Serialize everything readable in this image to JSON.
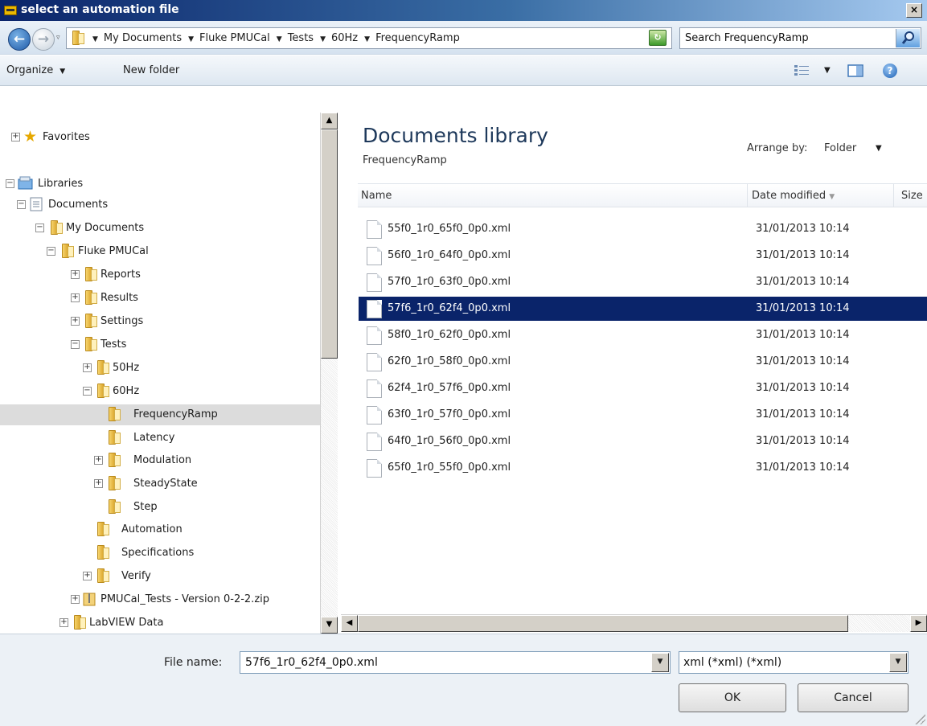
{
  "window": {
    "title": "select an automation file",
    "close_glyph": "×"
  },
  "address": {
    "crumbs": [
      "My Documents",
      "Fluke PMUCal",
      "Tests",
      "60Hz",
      "FrequencyRamp"
    ],
    "search_placeholder": "Search FrequencyRamp"
  },
  "toolbar": {
    "organize_label": "Organize",
    "newfolder_label": "New folder",
    "help_glyph": "?"
  },
  "tree": {
    "favorites": "Favorites",
    "libraries": "Libraries",
    "documents": "Documents",
    "my_documents": "My Documents",
    "fluke_pmucal": "Fluke PMUCal",
    "reports": "Reports",
    "results": "Results",
    "settings": "Settings",
    "tests": "Tests",
    "hz50": "50Hz",
    "hz60": "60Hz",
    "frequencyramp": "FrequencyRamp",
    "latency": "Latency",
    "modulation": "Modulation",
    "steadystate": "SteadyState",
    "step": "Step",
    "automation": "Automation",
    "specifications": "Specifications",
    "verify": "Verify",
    "zip": "PMUCal_Tests - Version 0-2-2.zip",
    "labview": "LabVIEW Data"
  },
  "content": {
    "library_title": "Documents library",
    "library_subtitle": "FrequencyRamp",
    "arrange_label": "Arrange by:",
    "arrange_value": "Folder",
    "columns": {
      "name": "Name",
      "date": "Date modified",
      "size": "Size"
    },
    "files": [
      {
        "name": "55f0_1r0_65f0_0p0.xml",
        "date": "31/01/2013 10:14"
      },
      {
        "name": "56f0_1r0_64f0_0p0.xml",
        "date": "31/01/2013 10:14"
      },
      {
        "name": "57f0_1r0_63f0_0p0.xml",
        "date": "31/01/2013 10:14"
      },
      {
        "name": "57f6_1r0_62f4_0p0.xml",
        "date": "31/01/2013 10:14"
      },
      {
        "name": "58f0_1r0_62f0_0p0.xml",
        "date": "31/01/2013 10:14"
      },
      {
        "name": "62f0_1r0_58f0_0p0.xml",
        "date": "31/01/2013 10:14"
      },
      {
        "name": "62f4_1r0_57f6_0p0.xml",
        "date": "31/01/2013 10:14"
      },
      {
        "name": "63f0_1r0_57f0_0p0.xml",
        "date": "31/01/2013 10:14"
      },
      {
        "name": "64f0_1r0_56f0_0p0.xml",
        "date": "31/01/2013 10:14"
      },
      {
        "name": "65f0_1r0_55f0_0p0.xml",
        "date": "31/01/2013 10:14"
      }
    ],
    "selected_file": "57f6_1r0_62f4_0p0.xml"
  },
  "bottom": {
    "filename_label": "File name:",
    "filename_value": "57f6_1r0_62f4_0p0.xml",
    "filetype_value": "xml (*xml) (*xml)",
    "ok_label": "OK",
    "cancel_label": "Cancel"
  },
  "colors": {
    "selection": "#0a246a",
    "title_bar": "#0a246a",
    "library_title": "#1e395b"
  }
}
